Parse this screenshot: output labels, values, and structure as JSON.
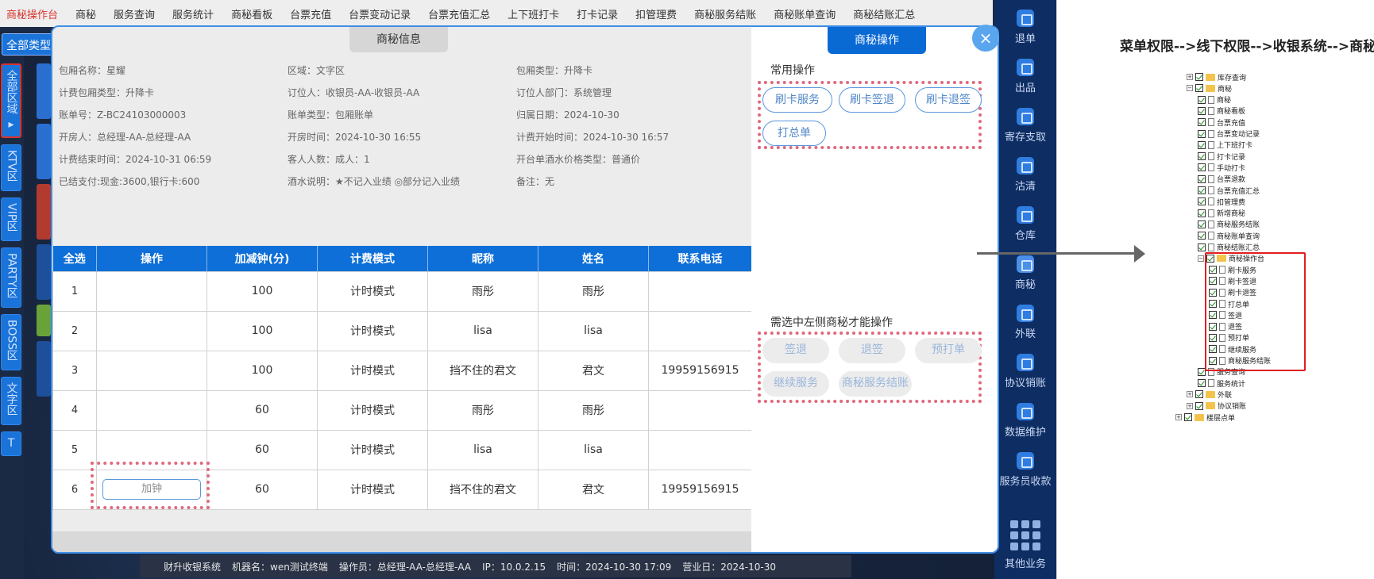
{
  "topnav": {
    "items": [
      "商秘操作台",
      "商秘",
      "服务查询",
      "服务统计",
      "商秘看板",
      "台票充值",
      "台票变动记录",
      "台票充值汇总",
      "上下班打卡",
      "打卡记录",
      "扣管理费",
      "商秘服务结账",
      "商秘账单查询",
      "商秘结账汇总"
    ]
  },
  "category_button": "全部类型",
  "left_rail": [
    {
      "label": "全部区域"
    },
    {
      "label": "KTV区"
    },
    {
      "label": "VIP区"
    },
    {
      "label": "PARTY区"
    },
    {
      "label": "BOSS区"
    },
    {
      "label": "文字区"
    },
    {
      "label": "T"
    }
  ],
  "right_rail": [
    {
      "label": "退单"
    },
    {
      "label": "出品"
    },
    {
      "label": "寄存支取"
    },
    {
      "label": "沽清"
    },
    {
      "label": "仓库"
    },
    {
      "label": "商秘"
    },
    {
      "label": "外联"
    },
    {
      "label": "协议销账"
    },
    {
      "label": "数据维护"
    },
    {
      "label": "服务员收款"
    },
    {
      "label": "其他业务"
    }
  ],
  "status_bar": {
    "system": "财升收银系统",
    "machine": "机器名：wen测试终端",
    "operator": "操作员：总经理-AA-总经理-AA",
    "ip": "IP：10.0.2.15",
    "time": "时间：2024-10-30 17:09",
    "business_day": "营业日：2024-10-30"
  },
  "modal": {
    "info_tab": "商秘信息",
    "ops_tab": "商秘操作",
    "close_icon": "×",
    "info": [
      "包厢名称：星耀",
      "区域：文字区",
      "包厢类型：升降卡",
      "计费包厢类型：升降卡",
      "订位人：收银员-AA-收银员-AA",
      "订位人部门：系统管理",
      "账单号：Z-BC24103000003",
      "账单类型：包厢账单",
      "归属日期：2024-10-30",
      "开房人：总经理-AA-总经理-AA",
      "开房时间：2024-10-30 16:55",
      "计费开始时间：2024-10-30 16:57",
      "计费结束时间：2024-10-31 06:59",
      "客人人数：成人：1",
      "开台单酒水价格类型：普通价",
      "已结支付:现金:3600,银行卡:600",
      "酒水说明：★不记入业绩 ◎部分记入业绩",
      "备注：无"
    ],
    "table": {
      "headers": [
        "全选",
        "操作",
        "加减钟(分)",
        "计费模式",
        "昵称",
        "姓名",
        "联系电话"
      ],
      "add_clock_label": "加钟",
      "rows": [
        [
          "1",
          "",
          "100",
          "计时模式",
          "雨彤",
          "雨彤",
          ""
        ],
        [
          "2",
          "",
          "100",
          "计时模式",
          "lisa",
          "lisa",
          ""
        ],
        [
          "3",
          "",
          "100",
          "计时模式",
          "挡不住的君文",
          "君文",
          "19959156915"
        ],
        [
          "4",
          "",
          "60",
          "计时模式",
          "雨彤",
          "雨彤",
          ""
        ],
        [
          "5",
          "",
          "60",
          "计时模式",
          "lisa",
          "lisa",
          ""
        ],
        [
          "6",
          "",
          "60",
          "计时模式",
          "挡不住的君文",
          "君文",
          "19959156915"
        ]
      ]
    },
    "common_ops_label": "常用操作",
    "common_ops": [
      "刷卡服务",
      "刷卡签退",
      "刷卡退签",
      "打总单"
    ],
    "selected_ops_label": "需选中左侧商秘才能操作",
    "selected_ops": [
      "签退",
      "退签",
      "预打单",
      "继续服务",
      "商秘服务结账"
    ]
  },
  "annotation": {
    "title": "菜单权限-->线下权限-->收银系统-->商秘",
    "tree": [
      {
        "label": "库存查询",
        "kind": "folder",
        "level": 0
      },
      {
        "label": "商秘",
        "kind": "folder",
        "level": 0
      },
      {
        "label": "商秘",
        "kind": "file",
        "level": 1
      },
      {
        "label": "商秘看板",
        "kind": "file",
        "level": 1
      },
      {
        "label": "台票充值",
        "kind": "file",
        "level": 1
      },
      {
        "label": "台票变动记录",
        "kind": "file",
        "level": 1
      },
      {
        "label": "上下班打卡",
        "kind": "file",
        "level": 1
      },
      {
        "label": "打卡记录",
        "kind": "file",
        "level": 1
      },
      {
        "label": "手动打卡",
        "kind": "file",
        "level": 1
      },
      {
        "label": "台票退款",
        "kind": "file",
        "level": 1
      },
      {
        "label": "台票充值汇总",
        "kind": "file",
        "level": 1
      },
      {
        "label": "扣管理费",
        "kind": "file",
        "level": 1
      },
      {
        "label": "新增商秘",
        "kind": "file",
        "level": 1
      },
      {
        "label": "商秘服务结账",
        "kind": "file",
        "level": 1
      },
      {
        "label": "商秘账单查询",
        "kind": "file",
        "level": 1
      },
      {
        "label": "商秘结账汇总",
        "kind": "file",
        "level": 1
      },
      {
        "label": "商秘操作台",
        "kind": "folder",
        "level": 1
      },
      {
        "label": "刷卡服务",
        "kind": "file",
        "level": 2
      },
      {
        "label": "刷卡签退",
        "kind": "file",
        "level": 2
      },
      {
        "label": "刷卡退签",
        "kind": "file",
        "level": 2
      },
      {
        "label": "打总单",
        "kind": "file",
        "level": 2
      },
      {
        "label": "签退",
        "kind": "file",
        "level": 2
      },
      {
        "label": "退签",
        "kind": "file",
        "level": 2
      },
      {
        "label": "预打单",
        "kind": "file",
        "level": 2
      },
      {
        "label": "继续服务",
        "kind": "file",
        "level": 2
      },
      {
        "label": "商秘服务结账",
        "kind": "file",
        "level": 2
      },
      {
        "label": "服务查询",
        "kind": "file",
        "level": 1
      },
      {
        "label": "服务统计",
        "kind": "file",
        "level": 1
      },
      {
        "label": "外联",
        "kind": "folder",
        "level": 0
      },
      {
        "label": "协议销账",
        "kind": "folder",
        "level": 0
      },
      {
        "label": "楼层点单",
        "kind": "folder",
        "level": -1
      }
    ]
  }
}
